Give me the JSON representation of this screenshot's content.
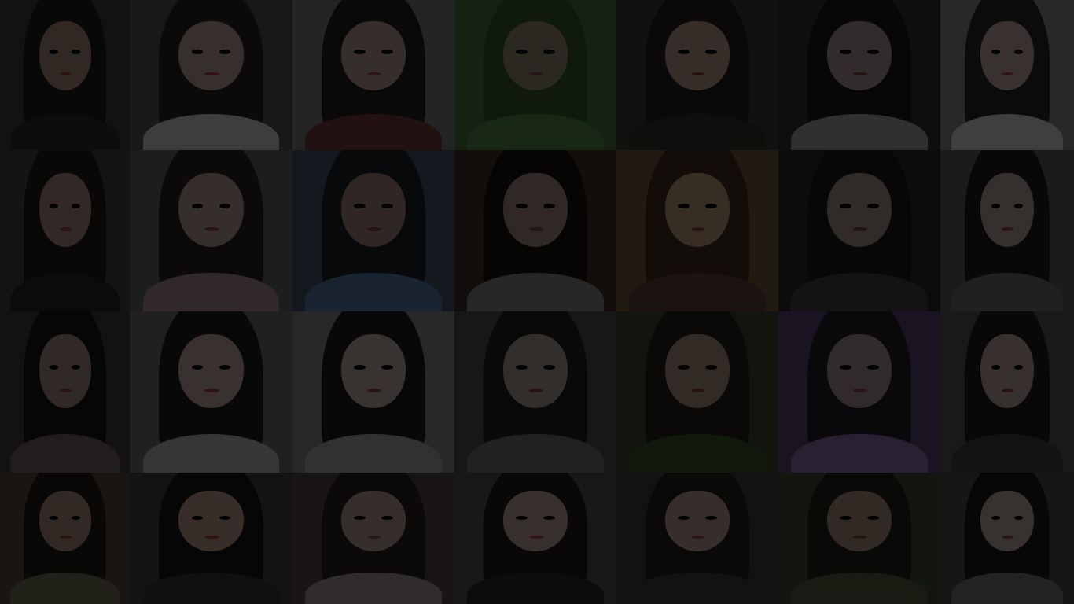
{
  "background": {
    "type": "photo-collage",
    "rows": 4,
    "columns": 7,
    "overlay": "dark-dim",
    "tiles": [
      {
        "bg": "#2b2826",
        "hair": "#141212",
        "face": "#6e5a50",
        "body": "#1e1d1e",
        "lip": "#5b2c2c"
      },
      {
        "bg": "#3a3534",
        "hair": "#1a1616",
        "face": "#7b6860",
        "body": "#8b8785",
        "lip": "#6a2b2b"
      },
      {
        "bg": "#514f52",
        "hair": "#161414",
        "face": "#776760",
        "body": "#4c2626",
        "lip": "#5f2f2f"
      },
      {
        "bg": "#2f4a28",
        "hair": "#233a1d",
        "face": "#605a4b",
        "body": "#355a2f",
        "lip": "#553030"
      },
      {
        "bg": "#2c2624",
        "hair": "#171312",
        "face": "#7a655a",
        "body": "#241f1e",
        "lip": "#5c2e2b"
      },
      {
        "bg": "#201f21",
        "hair": "#121112",
        "face": "#6d6160",
        "body": "#6b6a6e",
        "lip": "#512b2b"
      },
      {
        "bg": "#5b5759",
        "hair": "#1c1a1c",
        "face": "#7d6e6a",
        "body": "#8d8b8e",
        "lip": "#6a3030"
      },
      {
        "bg": "#2f2b2b",
        "hair": "#17130f",
        "face": "#6f5b55",
        "body": "#1b1a1a",
        "lip": "#5e2c2c"
      },
      {
        "bg": "#3c4246",
        "hair": "#1a1614",
        "face": "#79665d",
        "body": "#6c5a5b",
        "lip": "#5e2e2e"
      },
      {
        "bg": "#2c3846",
        "hair": "#121418",
        "face": "#6a5850",
        "body": "#3b4e6a",
        "lip": "#5a2b2b"
      },
      {
        "bg": "#2a1e1a",
        "hair": "#0f0c0b",
        "face": "#685a55",
        "body": "#5a5758",
        "lip": "#542a2a"
      },
      {
        "bg": "#4a3a26",
        "hair": "#2a1d16",
        "face": "#7a644f",
        "body": "#3a2c24",
        "lip": "#5d2e28"
      },
      {
        "bg": "#1e1c1e",
        "hair": "#121012",
        "face": "#6c5f5c",
        "body": "#2d2b2d",
        "lip": "#562c2c"
      },
      {
        "bg": "#3e3a3b",
        "hair": "#151313",
        "face": "#776a64",
        "body": "#4a4647",
        "lip": "#5e2e2e"
      },
      {
        "bg": "#2a2626",
        "hair": "#100e0e",
        "face": "#6d5c58",
        "body": "#4a4244",
        "lip": "#5e2a2a"
      },
      {
        "bg": "#4a4646",
        "hair": "#141212",
        "face": "#7c6e6a",
        "body": "#7b7776",
        "lip": "#632e2e"
      },
      {
        "bg": "#585a5a",
        "hair": "#121212",
        "face": "#7c706c",
        "body": "#6b6d6d",
        "lip": "#5f2e2e"
      },
      {
        "bg": "#343434",
        "hair": "#141414",
        "face": "#6e6662",
        "body": "#4a4a4a",
        "lip": "#572d2d"
      },
      {
        "bg": "#2a2e1e",
        "hair": "#191611",
        "face": "#6d5e52",
        "body": "#27361c",
        "lip": "#562b28"
      },
      {
        "bg": "#3a2a4c",
        "hair": "#16121a",
        "face": "#6c5e60",
        "body": "#5b4b6d",
        "lip": "#5a2b30"
      },
      {
        "bg": "#3b3838",
        "hair": "#141212",
        "face": "#7a6c68",
        "body": "#2d2a2a",
        "lip": "#612c2c"
      },
      {
        "bg": "#3b3025",
        "hair": "#171310",
        "face": "#6f5c50",
        "body": "#4b4b3a",
        "lip": "#5e2d28"
      },
      {
        "bg": "#2c2a2a",
        "hair": "#100e0e",
        "face": "#7a665e",
        "body": "#262424",
        "lip": "#6a2a2a"
      },
      {
        "bg": "#3a3030",
        "hair": "#1c1514",
        "face": "#776660",
        "body": "#6b6363",
        "lip": "#602d2d"
      },
      {
        "bg": "#3a3333",
        "hair": "#141010",
        "face": "#7b6a65",
        "body": "#1d1a1b",
        "lip": "#7a2a2a"
      },
      {
        "bg": "#2a2626",
        "hair": "#1a1413",
        "face": "#7a6760",
        "body": "#2c2726",
        "lip": "#5e2e2e"
      },
      {
        "bg": "#2a2f22",
        "hair": "#161410",
        "face": "#6c5c50",
        "body": "#3a3b2c",
        "lip": "#582c28"
      },
      {
        "bg": "#323033",
        "hair": "#131113",
        "face": "#7b6d6a",
        "body": "#504d52",
        "lip": "#602e2e"
      }
    ]
  }
}
